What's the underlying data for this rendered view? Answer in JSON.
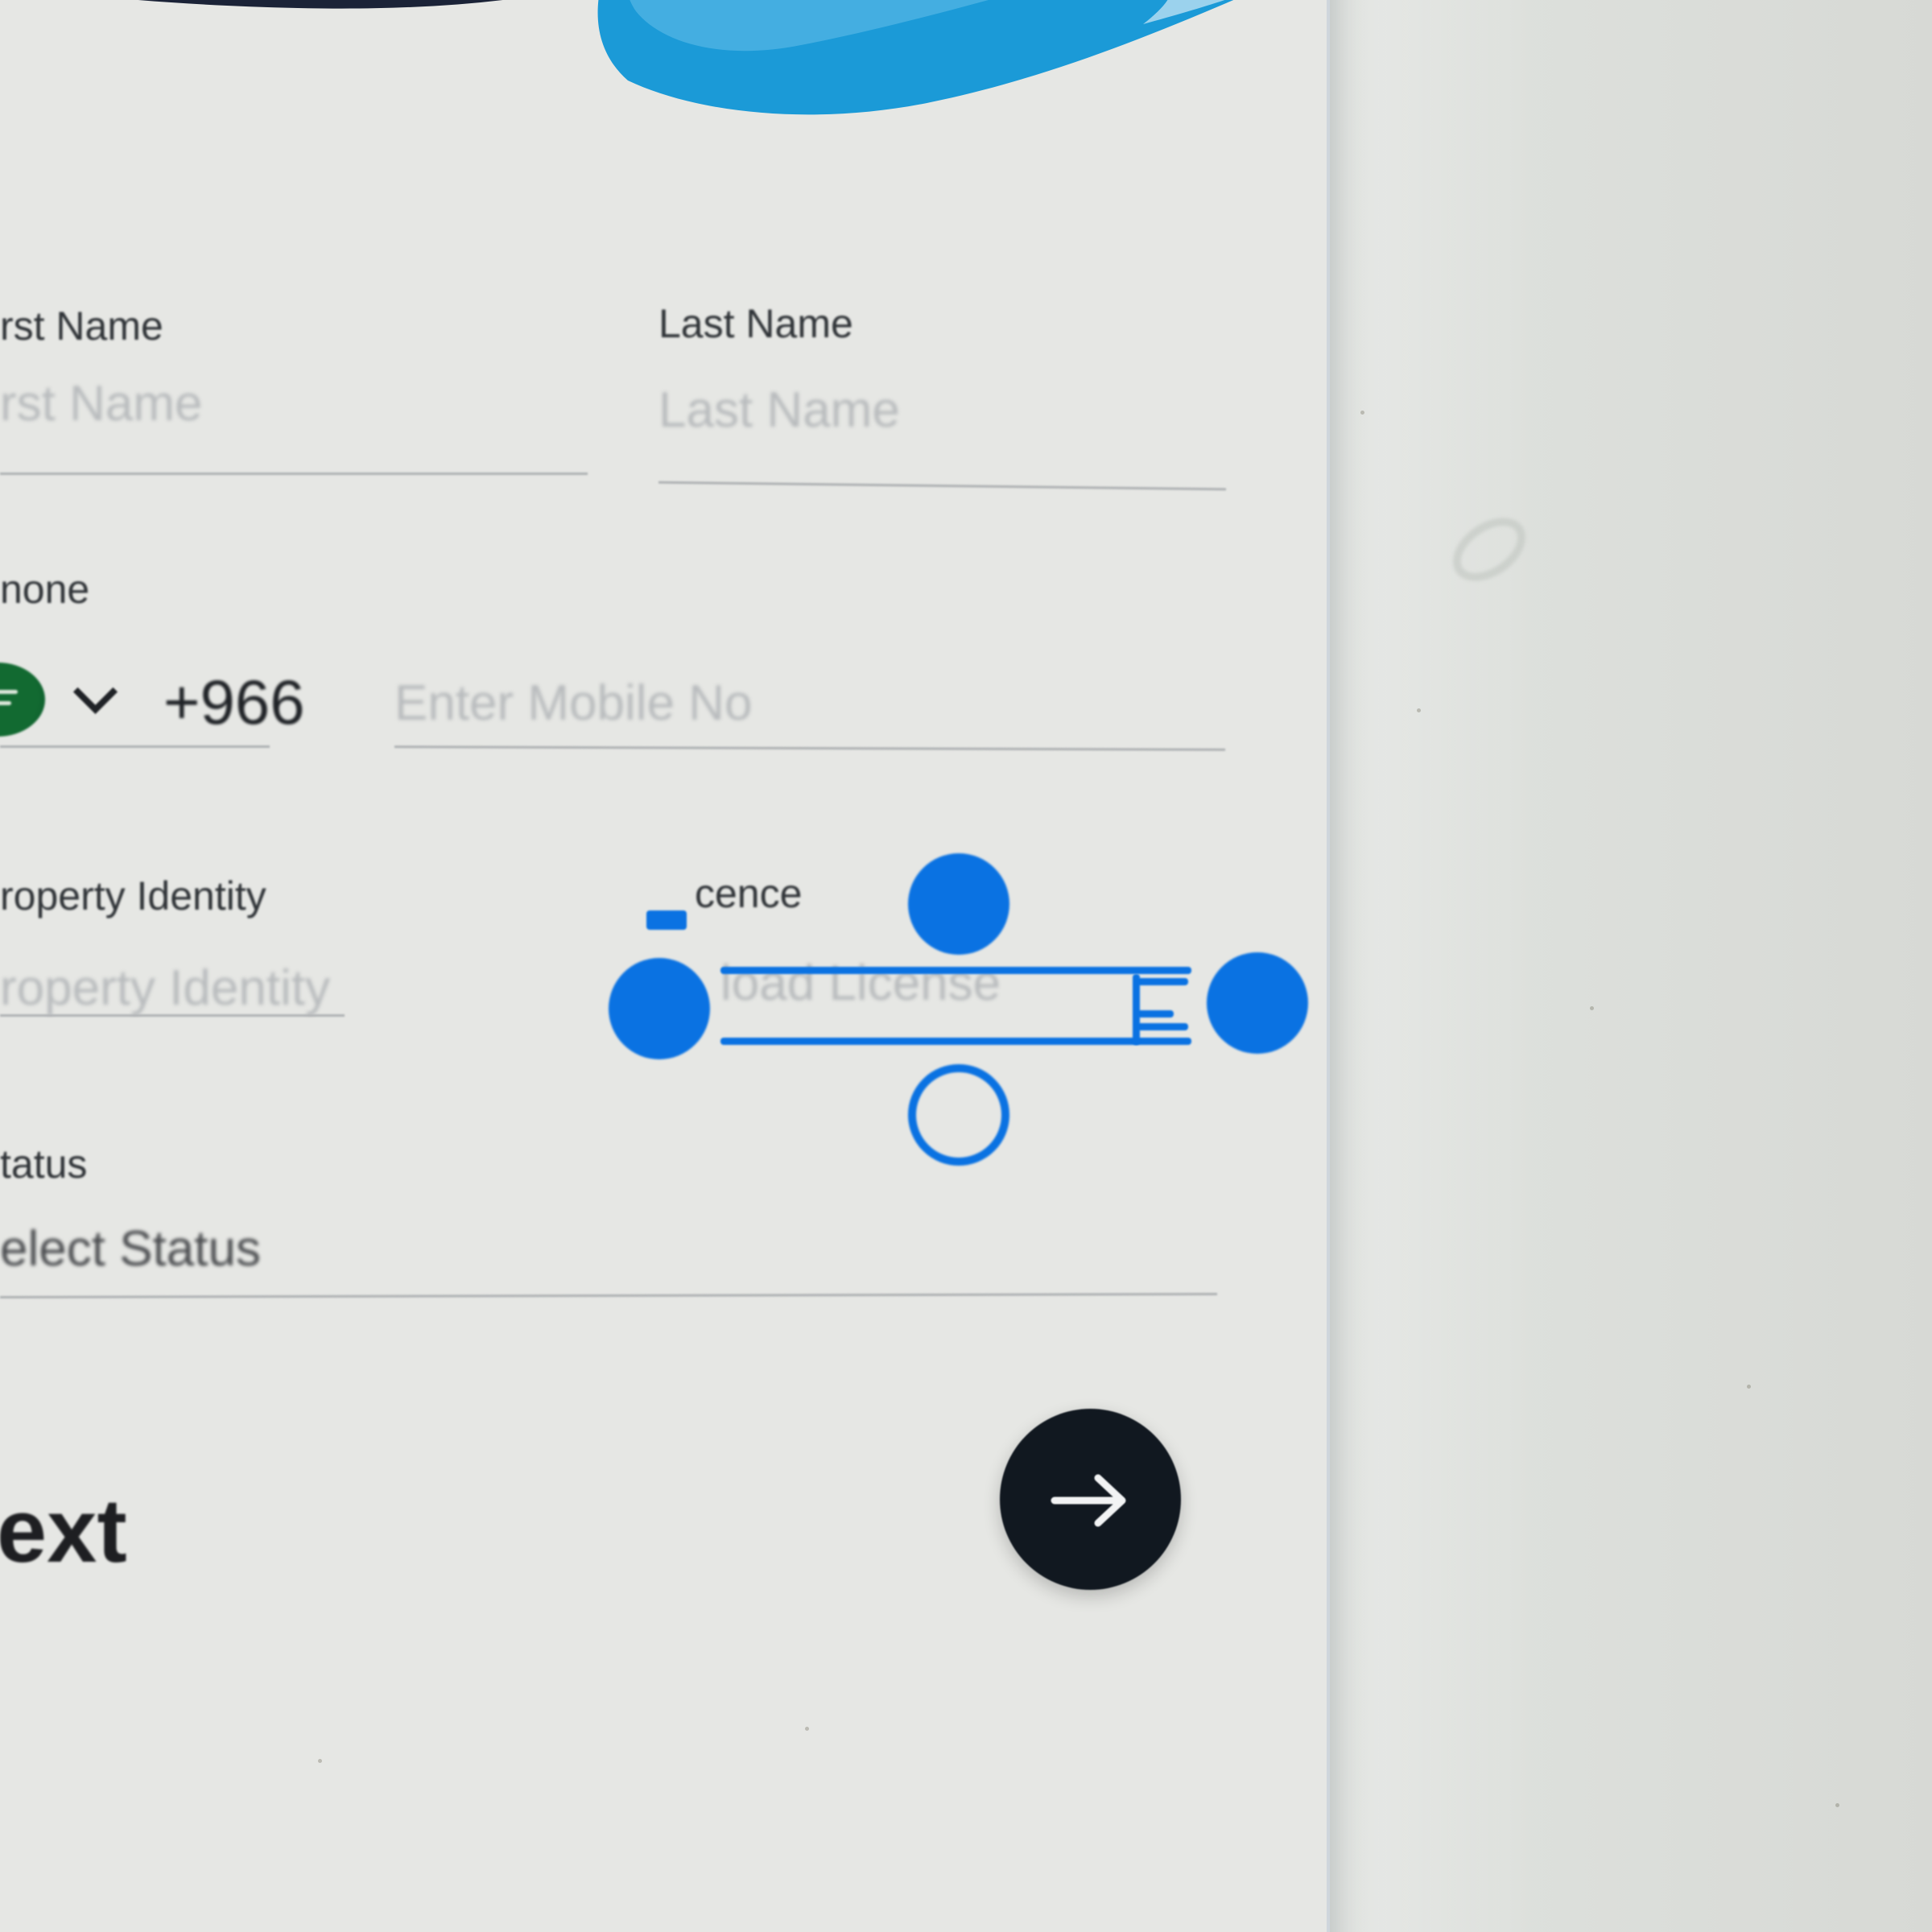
{
  "form": {
    "first_name": {
      "label": "rst Name",
      "placeholder": "rst Name"
    },
    "last_name": {
      "label": "Last Name",
      "placeholder": "Last Name"
    },
    "phone": {
      "label": "none",
      "country_code": "+966",
      "placeholder": "Enter Mobile No"
    },
    "property_identity": {
      "label": "roperty Identity",
      "placeholder": "roperty Identity"
    },
    "licence": {
      "label": "cence",
      "placeholder": "load License"
    },
    "status": {
      "label": "tatus",
      "placeholder": "elect Status"
    }
  },
  "actions": {
    "next_label": "Next"
  },
  "colors": {
    "accent_blue": "#0a72e2",
    "header_dark": "#1b2337",
    "header_blue": "#1b9ad7",
    "button_dark": "#111820",
    "saudi_flag_green": "#126a31"
  },
  "icons": {
    "country_flag": "saudi-flag-icon",
    "country_dropdown": "chevron-down-icon",
    "next": "arrow-right-icon"
  }
}
